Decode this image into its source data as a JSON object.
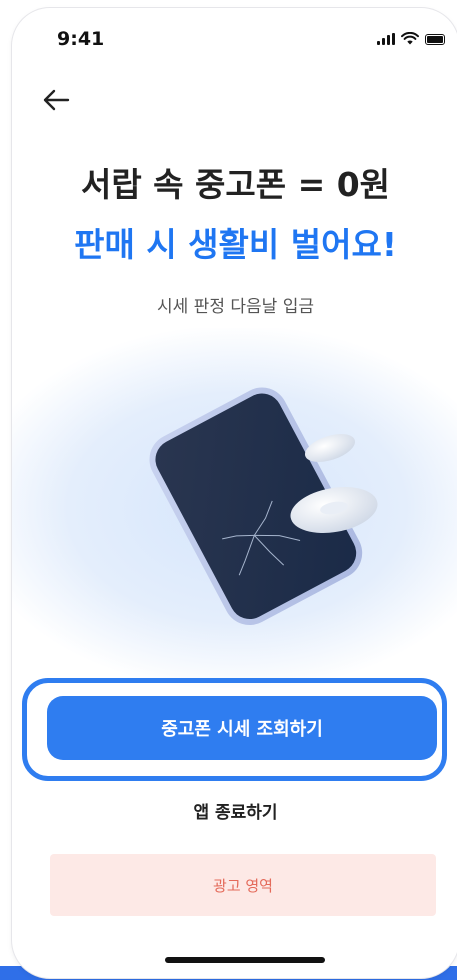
{
  "status_bar": {
    "time": "9:41"
  },
  "header": {
    "title_line1": "서랍 속 중고폰 = 0원",
    "title_line2": "판매 시 생활비 벌어요!",
    "subtitle": "시세 판정 다음날 입금"
  },
  "actions": {
    "primary_label": "중고폰 시세 조회하기",
    "secondary_label": "앱 종료하기"
  },
  "ad": {
    "label": "광고 영역"
  },
  "colors": {
    "accent": "#2f7df0",
    "headline_blue": "#1f76f2",
    "ad_background": "#fde9e6",
    "ad_text": "#e46a5a"
  },
  "icons": [
    "back-arrow-icon",
    "signal-icon",
    "wifi-icon",
    "battery-icon",
    "cracked-phone-illustration",
    "coin-illustration"
  ]
}
